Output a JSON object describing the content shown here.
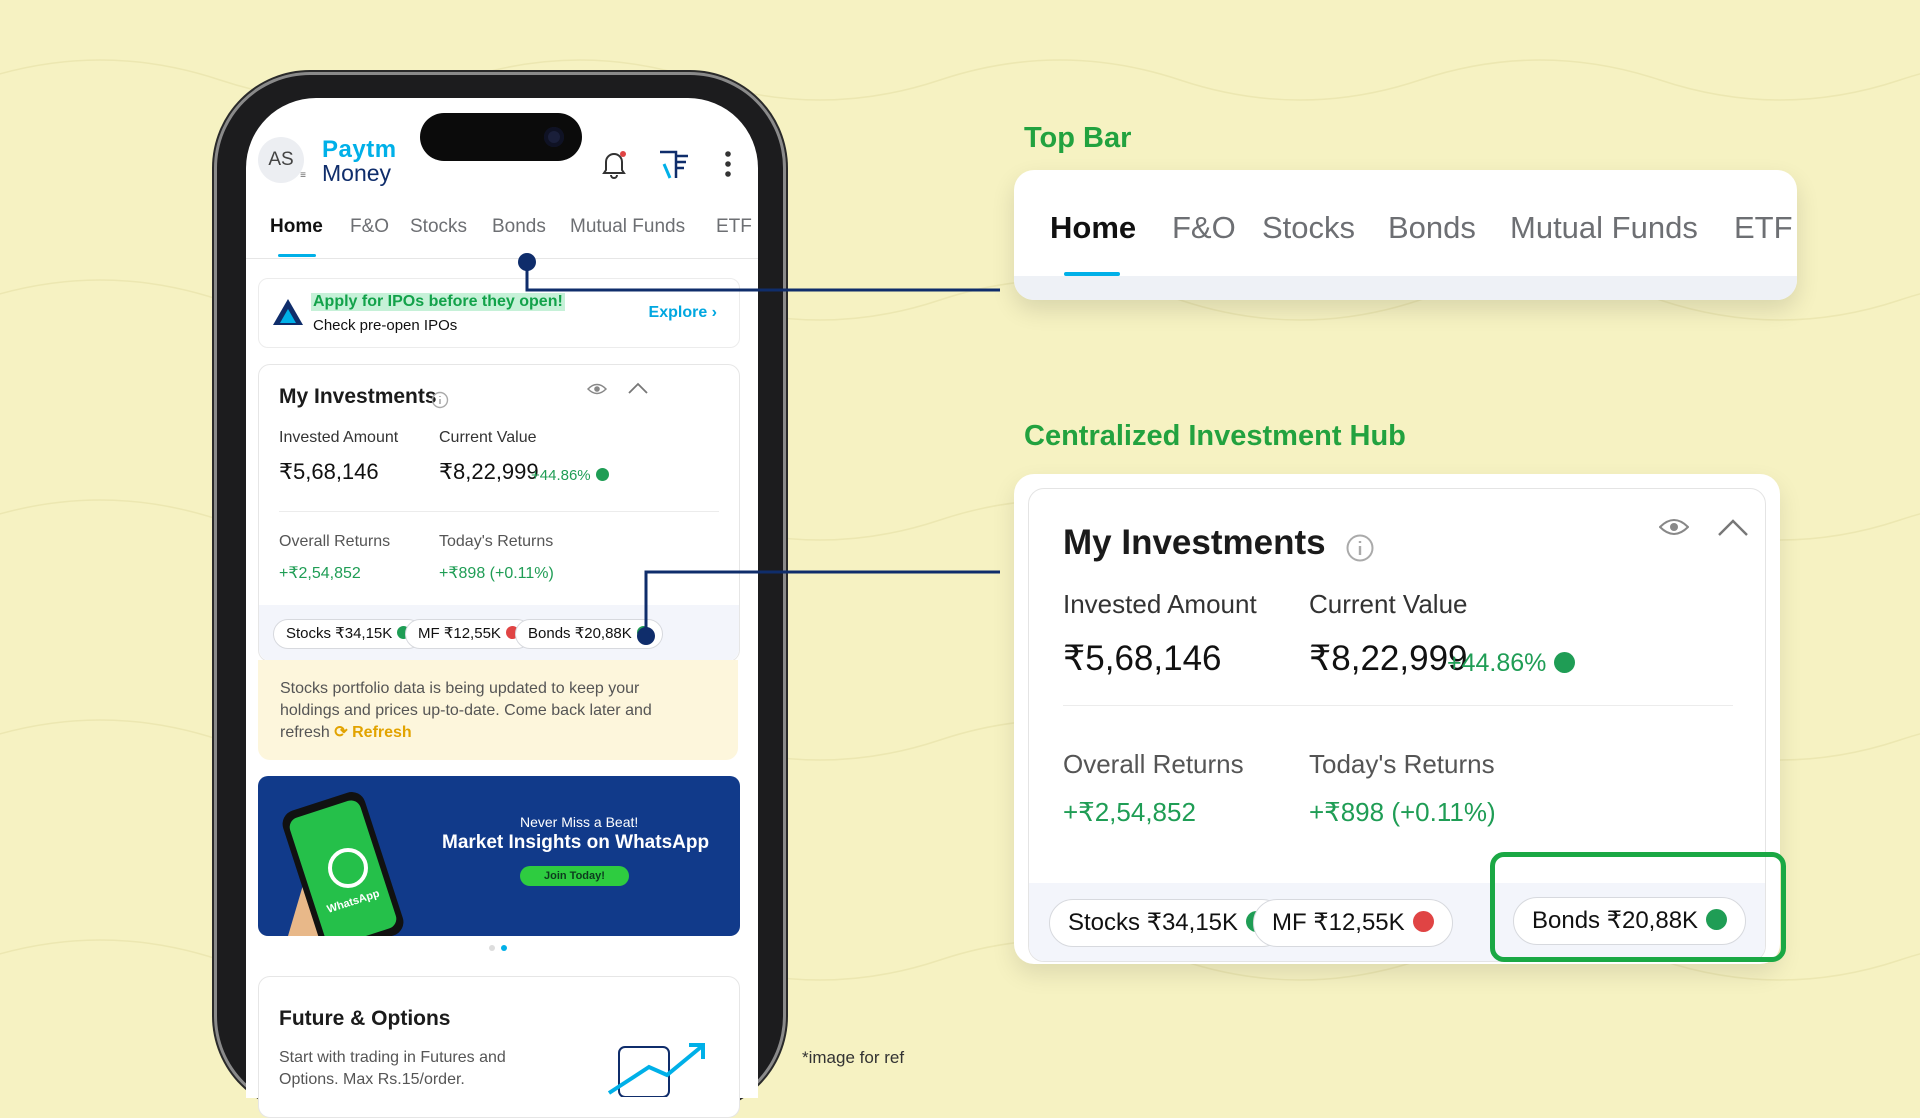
{
  "phone": {
    "avatar": "AS",
    "avatar_menu": "≡",
    "logo_brand": "Paytm",
    "logo_product": "Money",
    "tabs": [
      "Home",
      "F&O",
      "Stocks",
      "Bonds",
      "Mutual Funds",
      "ETF"
    ],
    "ipo_banner": {
      "headline": "Apply for IPOs before they open!",
      "sub": "Check pre-open IPOs",
      "cta": "Explore ›"
    },
    "investments": {
      "title": "My Investments",
      "invested_label": "Invested Amount",
      "invested_value": "₹5,68,146",
      "current_label": "Current Value",
      "current_value": "₹8,22,999",
      "current_change": "+44.86%",
      "overall_label": "Overall Returns",
      "overall_value": "+₹2,54,852",
      "today_label": "Today's Returns",
      "today_value": "+₹898 (+0.11%)",
      "chips": [
        {
          "label": "Stocks ₹34,15K",
          "trend": "up"
        },
        {
          "label": "MF ₹12,55K",
          "trend": "down"
        },
        {
          "label": "Bonds ₹20,88K",
          "trend": "up"
        }
      ]
    },
    "notice": {
      "text": "Stocks portfolio data is being updated to keep your holdings and prices up-to-date. Come back later and refresh",
      "link": "Refresh"
    },
    "whatsapp_banner": {
      "line1": "Never Miss a Beat!",
      "line2": "Market Insights on WhatsApp",
      "cta": "Join Today!",
      "logo_text": "WhatsApp"
    },
    "fo_card": {
      "title": "Future & Options",
      "sub": "Start with trading in Futures and Options. Max Rs.15/order."
    }
  },
  "callouts": {
    "top_bar_title": "Top Bar",
    "top_bar_tabs": [
      "Home",
      "F&O",
      "Stocks",
      "Bonds",
      "Mutual Funds",
      "ETF"
    ],
    "hub_title": "Centralized Investment Hub",
    "hub": {
      "title": "My Investments",
      "invested_label": "Invested Amount",
      "invested_value": "₹5,68,146",
      "current_label": "Current Value",
      "current_value": "₹8,22,999",
      "current_change": "+44.86%",
      "overall_label": "Overall Returns",
      "overall_value": "+₹2,54,852",
      "today_label": "Today's Returns",
      "today_value": "+₹898 (+0.11%)",
      "chips": [
        "Stocks ₹34,15K",
        "MF ₹12,55K",
        "Bonds ₹20,88K"
      ]
    }
  },
  "footnote": "*image for ref",
  "colors": {
    "background": "#f6f2c2",
    "accent_green": "#22a23f",
    "brand_blue": "#00b0e8",
    "navy": "#0f2d6b",
    "up": "#1f9d55",
    "down": "#e04444"
  }
}
